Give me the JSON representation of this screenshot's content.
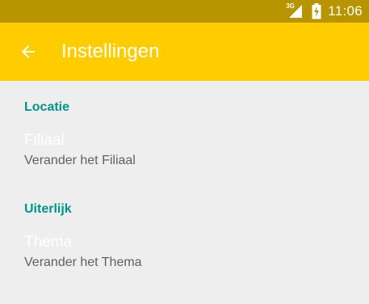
{
  "status_bar": {
    "network_type": "3G",
    "time": "11:06",
    "network_icon": "signal-icon",
    "battery_icon": "battery-charging-icon"
  },
  "app_bar": {
    "title": "Instellingen",
    "back_icon": "arrow-back-icon",
    "background_color": "#ffcc00"
  },
  "settings": {
    "categories": [
      {
        "title": "Locatie",
        "items": [
          {
            "title": "Filiaal",
            "summary": "Verander het Filiaal"
          }
        ]
      },
      {
        "title": "Uiterlijk",
        "items": [
          {
            "title": "Thema",
            "summary": "Verander het Thema"
          }
        ]
      }
    ]
  },
  "colors": {
    "status_bar": "#b79400",
    "accent": "#009688",
    "background": "#eeeeee"
  }
}
